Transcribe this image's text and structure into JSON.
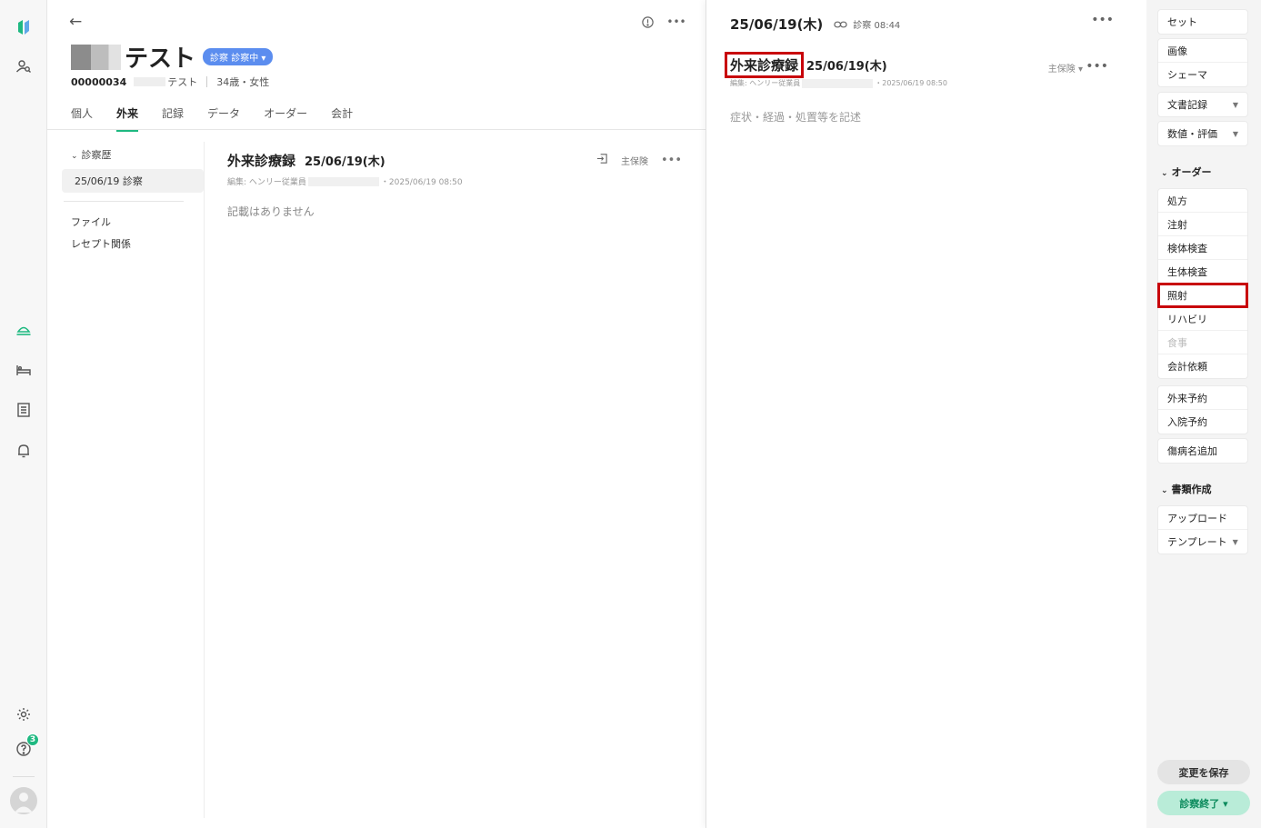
{
  "patient": {
    "name_suffix": "テスト",
    "status": "診察 診察中 ▾",
    "id": "00000034",
    "kana_suffix": "テスト",
    "age_gender": "34歳・女性",
    "tabs": [
      {
        "label": "個人"
      },
      {
        "label": "外来",
        "active": true
      },
      {
        "label": "記録"
      },
      {
        "label": "データ"
      },
      {
        "label": "オーダー"
      },
      {
        "label": "会計"
      }
    ],
    "history_header": "診察歴",
    "history_items": [
      "25/06/19 診察"
    ],
    "links": [
      "ファイル",
      "レセプト関係"
    ],
    "record": {
      "title": "外来診療録",
      "date": "25/06/19(木)",
      "insurance": "主保険",
      "meta_prefix": "編集: ヘンリー従業員",
      "meta_time": "・2025/06/19 08:50",
      "empty": "記載はありません"
    }
  },
  "editor": {
    "date": "25/06/19(木)",
    "link_text": "診察 08:44",
    "record_title": "外来診療録",
    "record_date": "25/06/19(木)",
    "insurance": "主保険 ▾",
    "meta_prefix": "編集: ヘンリー従業員",
    "meta_time": "・2025/06/19 08:50",
    "placeholder": "症状・経過・処置等を記述"
  },
  "sidebar": {
    "group1": [
      "セット"
    ],
    "group2": [
      "画像",
      "シェーマ"
    ],
    "doc_record": "文書記録",
    "value_eval": "数値・評価",
    "order_header": "オーダー",
    "orders": [
      {
        "label": "処方"
      },
      {
        "label": "注射"
      },
      {
        "label": "検体検査"
      },
      {
        "label": "生体検査"
      },
      {
        "label": "照射",
        "highlight": true
      },
      {
        "label": "リハビリ"
      },
      {
        "label": "食事",
        "disabled": true
      },
      {
        "label": "会計依頼"
      }
    ],
    "reservations": [
      "外来予約",
      "入院予約"
    ],
    "disease": "傷病名追加",
    "docs_header": "書類作成",
    "docs": [
      "アップロード",
      "テンプレート"
    ],
    "save_button": "変更を保存",
    "end_button": "診察終了 ▾"
  },
  "notifications": {
    "count": "3"
  },
  "colors": {
    "accent": "#1fb981",
    "status_pill": "#5b8def",
    "highlight": "#c8000a"
  }
}
